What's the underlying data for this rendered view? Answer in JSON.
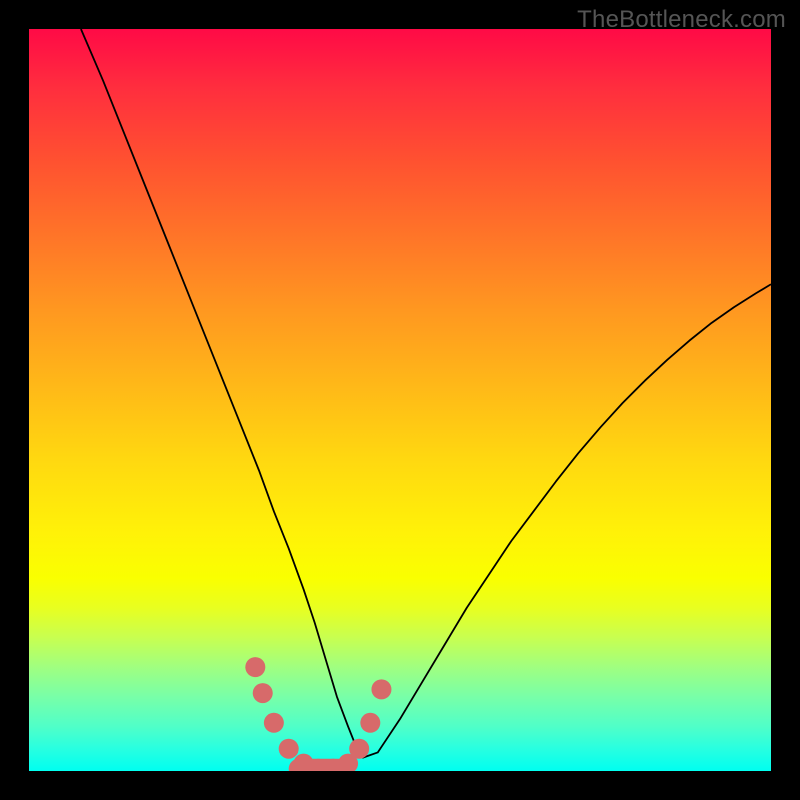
{
  "watermark": "TheBottleneck.com",
  "chart_data": {
    "type": "line",
    "title": "",
    "xlabel": "",
    "ylabel": "",
    "xlim": [
      0,
      100
    ],
    "ylim": [
      0,
      100
    ],
    "series": [
      {
        "name": "curve",
        "x": [
          7,
          10,
          13,
          16,
          19,
          22,
          25,
          28,
          31,
          33,
          35,
          37,
          38.5,
          40,
          41.5,
          43,
          44,
          45,
          47,
          50,
          53,
          56,
          59,
          62,
          65,
          68,
          71,
          74,
          77,
          80,
          83,
          86,
          89,
          92,
          95,
          98,
          100
        ],
        "y": [
          100,
          93,
          85.5,
          78,
          70.5,
          63,
          55.5,
          48,
          40.5,
          35,
          30,
          24.5,
          20,
          15,
          10,
          6,
          3.5,
          1.8,
          2.5,
          7,
          12,
          17,
          22,
          26.5,
          31,
          35,
          39,
          42.8,
          46.3,
          49.6,
          52.6,
          55.4,
          58,
          60.4,
          62.5,
          64.4,
          65.6
        ]
      }
    ],
    "markers": {
      "name": "highlight",
      "color": "#d76a6a",
      "x": [
        30.5,
        31.5,
        33,
        35,
        37,
        39,
        41,
        43,
        44.5,
        46,
        47.5
      ],
      "y": [
        14,
        10.5,
        6.5,
        3,
        1,
        0.3,
        0.3,
        1,
        3,
        6.5,
        11
      ]
    },
    "bar_segments": {
      "x_range": [
        35,
        43
      ],
      "y": 0.3
    }
  },
  "colors": {
    "frame_bg_top": "#ff0a46",
    "frame_bg_bottom": "#00fff0",
    "page_bg": "#000000",
    "curve": "#000000",
    "marker": "#d76a6a",
    "watermark": "#555555"
  }
}
